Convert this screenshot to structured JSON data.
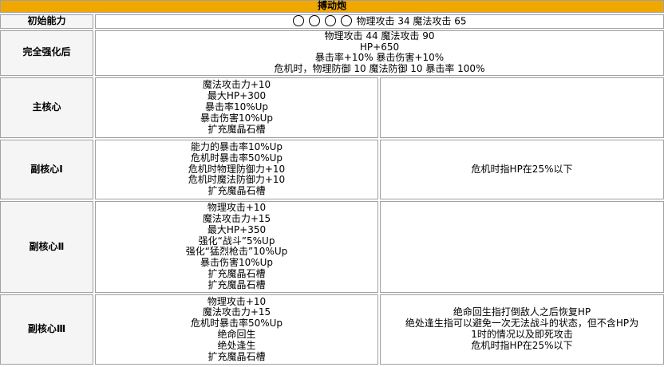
{
  "title": "搏动炮",
  "initial": {
    "label": "初始能力",
    "slot_count": 4,
    "text": "物理攻击 34 魔法攻击 65"
  },
  "enhanced": {
    "label": "完全强化后",
    "lines": [
      "物理攻击 44 魔法攻击 90",
      "HP+650",
      "暴击率+10% 暴击伤害+10%",
      "危机时，物理防御 10 魔法防御 10 暴击率 100%"
    ]
  },
  "main_core": {
    "label": "主核心",
    "effects": [
      "魔法攻击力+10",
      "最大HP+300",
      "暴击率10%Up",
      "暴击伤害10%Up",
      "扩充魔晶石槽"
    ],
    "notes": []
  },
  "sub_core_1": {
    "label": "副核心Ⅰ",
    "effects": [
      "能力的暴击率10%Up",
      "危机时暴击率50%Up",
      "危机时物理防御力+10",
      "危机时魔法防御力+10",
      "扩充魔晶石槽"
    ],
    "notes": [
      "危机时指HP在25%以下"
    ]
  },
  "sub_core_2": {
    "label": "副核心Ⅱ",
    "effects": [
      "物理攻击+10",
      "魔法攻击力+15",
      "最大HP+350",
      "强化“战斗”5%Up",
      "强化“猛烈枪击”10%Up",
      "暴击伤害10%Up",
      "扩充魔晶石槽",
      "扩充魔晶石槽"
    ],
    "notes": []
  },
  "sub_core_3": {
    "label": "副核心Ⅲ",
    "effects": [
      "物理攻击+10",
      "魔法攻击力+15",
      "危机时暴击率50%Up",
      "绝命回生",
      "绝处逢生",
      "扩充魔晶石槽"
    ],
    "notes": [
      "绝命回生指打倒敌人之后恢复HP",
      "绝处逢生指可以避免一次无法战斗的状态，但不含HP为",
      "1时的情况以及即死攻击",
      "危机时指HP在25%以下"
    ]
  }
}
